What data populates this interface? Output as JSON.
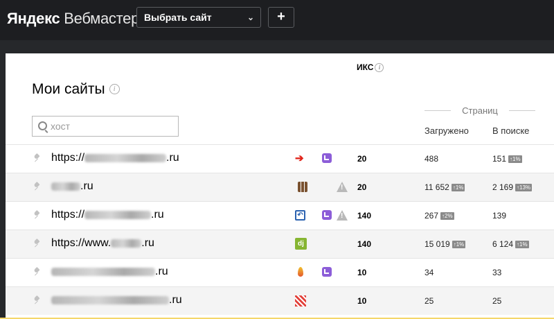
{
  "header": {
    "logo_brand": "Яндекс",
    "logo_product": "Вебмастер",
    "site_select_label": "Выбрать сайт",
    "add_button_label": "+"
  },
  "main": {
    "title": "Мои сайты",
    "search_placeholder": "хост",
    "group_header": "Страниц",
    "columns": {
      "iks": "ИКС",
      "loaded": "Загружено",
      "in_search": "В поиске"
    }
  },
  "sites": [
    {
      "url_prefix": "https://",
      "url_suffix": ".ru",
      "iks": "20",
      "loaded": "488",
      "loaded_badge": "",
      "in_search": "151",
      "in_search_badge": "↑1%",
      "icons": [
        "red-arrow-icon",
        "metrica-icon"
      ],
      "warning": false
    },
    {
      "url_prefix": "",
      "url_suffix": ".ru",
      "iks": "20",
      "loaded": "11 652",
      "loaded_badge": "↑1%",
      "in_search": "2 169",
      "in_search_badge": "↑13%",
      "icons": [
        "brown-favicon-icon"
      ],
      "warning": true
    },
    {
      "url_prefix": "https://",
      "url_suffix": ".ru",
      "iks": "140",
      "loaded": "267",
      "loaded_badge": "↑2%",
      "in_search": "139",
      "in_search_badge": "",
      "icons": [
        "blue-d-favicon-icon",
        "metrica-icon"
      ],
      "warning": true
    },
    {
      "url_prefix": "https://www.",
      "url_suffix": ".ru",
      "iks": "140",
      "loaded": "15 019",
      "loaded_badge": "↑1%",
      "in_search": "6 124",
      "in_search_badge": "↑1%",
      "icons": [
        "dj-favicon-icon"
      ],
      "warning": false
    },
    {
      "url_prefix": "",
      "url_suffix": ".ru",
      "iks": "10",
      "loaded": "34",
      "loaded_badge": "",
      "in_search": "33",
      "in_search_badge": "",
      "icons": [
        "flame-favicon-icon",
        "metrica-icon"
      ],
      "warning": false
    },
    {
      "url_prefix": "",
      "url_suffix": ".ru",
      "iks": "10",
      "loaded": "25",
      "loaded_badge": "",
      "in_search": "25",
      "in_search_badge": "",
      "icons": [
        "striped-favicon-icon"
      ],
      "warning": false
    }
  ]
}
